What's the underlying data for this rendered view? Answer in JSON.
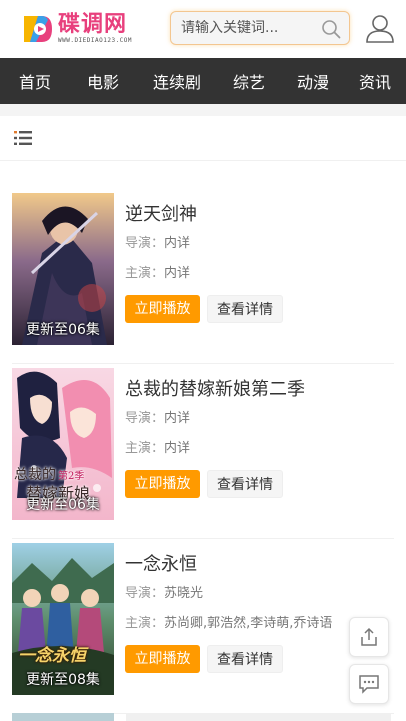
{
  "header": {
    "logo_text": "碟调网",
    "logo_url": "WWW.DIEDIAO123.COM",
    "search_placeholder": "请输入关键词..."
  },
  "nav": {
    "items": [
      {
        "label": "首页"
      },
      {
        "label": "电影"
      },
      {
        "label": "连续剧"
      },
      {
        "label": "综艺"
      },
      {
        "label": "动漫"
      },
      {
        "label": "资讯"
      }
    ]
  },
  "videos": [
    {
      "title": "逆天剑神",
      "director_label": "导演：",
      "director": "内详",
      "cast_label": "主演：",
      "cast": "内详",
      "badge": "更新至06集",
      "play_label": "立即播放",
      "detail_label": "查看详情"
    },
    {
      "title": "总裁的替嫁新娘第二季",
      "director_label": "导演：",
      "director": "内详",
      "cast_label": "主演：",
      "cast": "内详",
      "badge": "更新至06集",
      "poster_text": "总裁的替嫁新娘",
      "poster_season": "第2季",
      "play_label": "立即播放",
      "detail_label": "查看详情"
    },
    {
      "title": "一念永恒",
      "director_label": "导演：",
      "director": "苏晓光",
      "cast_label": "主演：",
      "cast": "苏尚卿,郭浩然,李诗萌,乔诗语",
      "badge": "更新至08集",
      "poster_text": "一念永恒",
      "play_label": "立即播放",
      "detail_label": "查看详情"
    }
  ],
  "icons": {
    "search": "search-icon",
    "user": "user-icon",
    "list": "list-icon",
    "share": "share-icon",
    "comment": "comment-icon"
  },
  "colors": {
    "accent": "#ff9a00",
    "brand": "#e8407d",
    "nav_bg": "#333333"
  }
}
